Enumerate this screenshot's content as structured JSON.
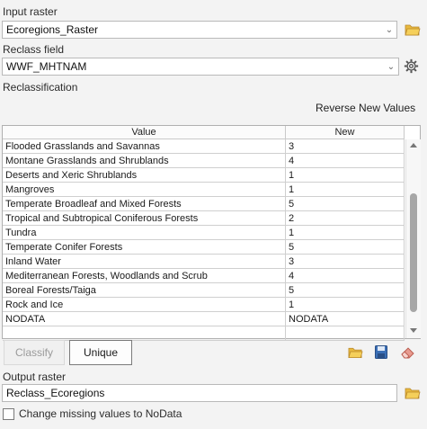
{
  "input_raster": {
    "label": "Input raster",
    "value": "Ecoregions_Raster"
  },
  "reclass_field": {
    "label": "Reclass field",
    "value": "WWF_MHTNAM"
  },
  "reclassification": {
    "label": "Reclassification",
    "reverse_label": "Reverse New Values",
    "columns": {
      "value": "Value",
      "new": "New"
    },
    "rows": [
      {
        "value": "Flooded Grasslands and Savannas",
        "new": "3"
      },
      {
        "value": "Montane Grasslands and Shrublands",
        "new": "4"
      },
      {
        "value": "Deserts and Xeric Shrublands",
        "new": "1"
      },
      {
        "value": "Mangroves",
        "new": "1"
      },
      {
        "value": "Temperate Broadleaf and Mixed Forests",
        "new": "5"
      },
      {
        "value": "Tropical and Subtropical Coniferous Forests",
        "new": "2"
      },
      {
        "value": "Tundra",
        "new": "1"
      },
      {
        "value": "Temperate Conifer Forests",
        "new": "5"
      },
      {
        "value": "Inland Water",
        "new": "3"
      },
      {
        "value": "Mediterranean Forests, Woodlands and Scrub",
        "new": "4"
      },
      {
        "value": "Boreal Forests/Taiga",
        "new": "5"
      },
      {
        "value": "Rock and Ice",
        "new": "1"
      },
      {
        "value": "NODATA",
        "new": "NODATA"
      },
      {
        "value": "",
        "new": ""
      }
    ]
  },
  "buttons": {
    "classify": "Classify",
    "unique": "Unique"
  },
  "output_raster": {
    "label": "Output raster",
    "value": "Reclass_Ecoregions"
  },
  "change_missing": {
    "label": "Change missing values to NoData",
    "checked": false
  },
  "colors": {
    "folder": "#e8b93e",
    "save": "#3b6fb6",
    "eraser": "#d9534f"
  }
}
